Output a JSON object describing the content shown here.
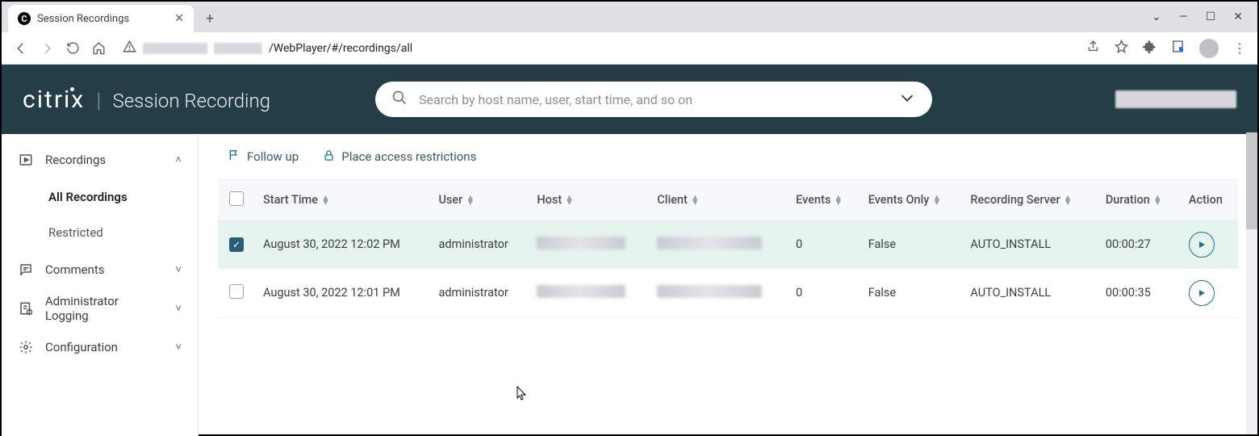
{
  "browser": {
    "tab_title": "Session Recordings",
    "url_visible_suffix": "/WebPlayer/#/recordings/all"
  },
  "header": {
    "brand": "citrix",
    "product": "Session Recording",
    "search_placeholder": "Search by host name, user, start time, and so on"
  },
  "sidebar": {
    "recordings_label": "Recordings",
    "all_label": "All Recordings",
    "restricted_label": "Restricted",
    "comments_label": "Comments",
    "admin_log_label": "Administrator Logging",
    "config_label": "Configuration"
  },
  "toolbar": {
    "follow_up": "Follow up",
    "restrict": "Place access restrictions"
  },
  "table": {
    "cols": {
      "start": "Start Time",
      "user": "User",
      "host": "Host",
      "client": "Client",
      "events": "Events",
      "events_only": "Events Only",
      "server": "Recording Server",
      "duration": "Duration",
      "action": "Action"
    },
    "rows": [
      {
        "selected": true,
        "start": "August 30, 2022 12:02 PM",
        "user": "administrator",
        "events": "0",
        "events_only": "False",
        "server": "AUTO_INSTALL",
        "duration": "00:00:27"
      },
      {
        "selected": false,
        "start": "August 30, 2022 12:01 PM",
        "user": "administrator",
        "events": "0",
        "events_only": "False",
        "server": "AUTO_INSTALL",
        "duration": "00:00:35"
      }
    ]
  }
}
